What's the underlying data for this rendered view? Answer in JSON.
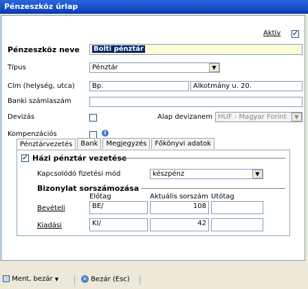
{
  "window": {
    "title": "Pénzeszköz űrlap"
  },
  "header": {
    "active_label": "Aktív",
    "active_checked": true
  },
  "fields": {
    "name_label": "Pénzeszköz neve",
    "name_value": "Bolti pénztár",
    "type_label": "Típus",
    "type_value": "Pénztár",
    "address_label": "Cím (helység, utca)",
    "city_value": "Bp.",
    "street_value": "Alkotmány u. 20.",
    "bank_label": "Banki számlaszám",
    "bank_value": "",
    "currency_label": "Devizás",
    "base_currency_label": "Alap devizanem",
    "base_currency_value": "HUF - Magyar Forint",
    "compensation_label": "Kompenzációs"
  },
  "tabs": [
    "Pénztárvezetés",
    "Bank",
    "Megjegyzés",
    "Főkönyvi adatok"
  ],
  "cash": {
    "group_label": "Házi pénztár vezetése",
    "group_checked": true,
    "payment_label": "Kapcsolódó fizetési mód",
    "payment_value": "készpénz",
    "numbering_label": "Bizonylat sorszámozása",
    "col_prefix": "Előtag",
    "col_current": "Aktuális sorszám",
    "col_suffix": "Utótag",
    "rows": [
      {
        "label": "Bevételi",
        "prefix": "BE/",
        "current": "108",
        "suffix": ""
      },
      {
        "label": "Kiadási",
        "prefix": "KI/",
        "current": "42",
        "suffix": ""
      }
    ]
  },
  "footer": {
    "save_label": "Ment, bezár",
    "close_label": "Bezár (Esc)"
  },
  "colors": {
    "title_bg": "#0a3fb8",
    "required_field_bg": "#fdfbd6",
    "selection": "#0a246a"
  }
}
